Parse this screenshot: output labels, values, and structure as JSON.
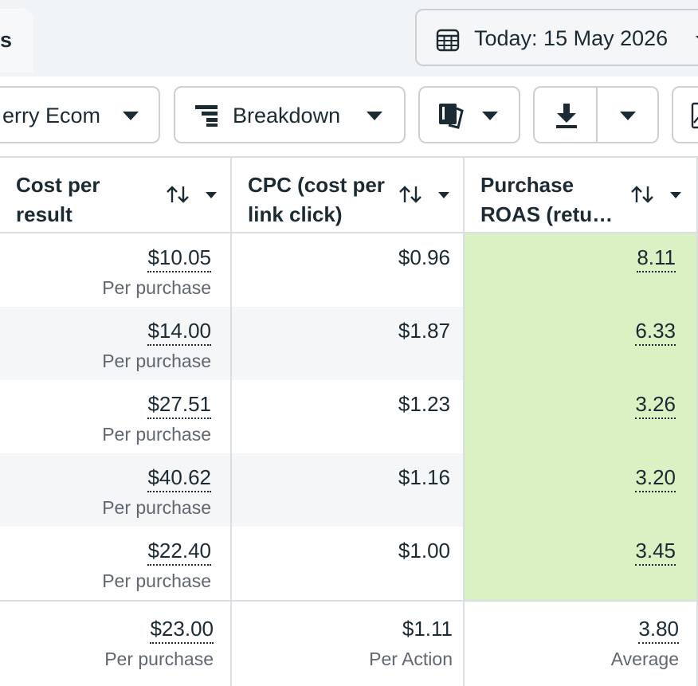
{
  "header": {
    "tab_label": "s",
    "date_label": "Today: 15 May 2026"
  },
  "toolbar": {
    "account_label": "erry Ecom",
    "breakdown_label": "Breakdown"
  },
  "table": {
    "columns": [
      {
        "label_line1": "Cost per",
        "label_line2": "result"
      },
      {
        "label_line1": "CPC (cost per",
        "label_line2": "link click)"
      },
      {
        "label_line1": "Purchase",
        "label_line2": "ROAS (retu…"
      }
    ],
    "rows": [
      {
        "cost": "$10.05",
        "cost_sub": "Per purchase",
        "cpc": "$0.96",
        "roas": "8.11"
      },
      {
        "cost": "$14.00",
        "cost_sub": "Per purchase",
        "cpc": "$1.87",
        "roas": "6.33"
      },
      {
        "cost": "$27.51",
        "cost_sub": "Per purchase",
        "cpc": "$1.23",
        "roas": "3.26"
      },
      {
        "cost": "$40.62",
        "cost_sub": "Per purchase",
        "cpc": "$1.16",
        "roas": "3.20"
      },
      {
        "cost": "$22.40",
        "cost_sub": "Per purchase",
        "cpc": "$1.00",
        "roas": "3.45"
      }
    ],
    "totals": {
      "cost": "$23.00",
      "cost_sub": "Per purchase",
      "cpc": "$1.11",
      "cpc_sub": "Per Action",
      "roas": "3.80",
      "roas_sub": "Average"
    }
  },
  "colors": {
    "roas_highlight": "#daf1c4",
    "alt_row": "#f5f6f7",
    "border": "#ccd0d5"
  }
}
